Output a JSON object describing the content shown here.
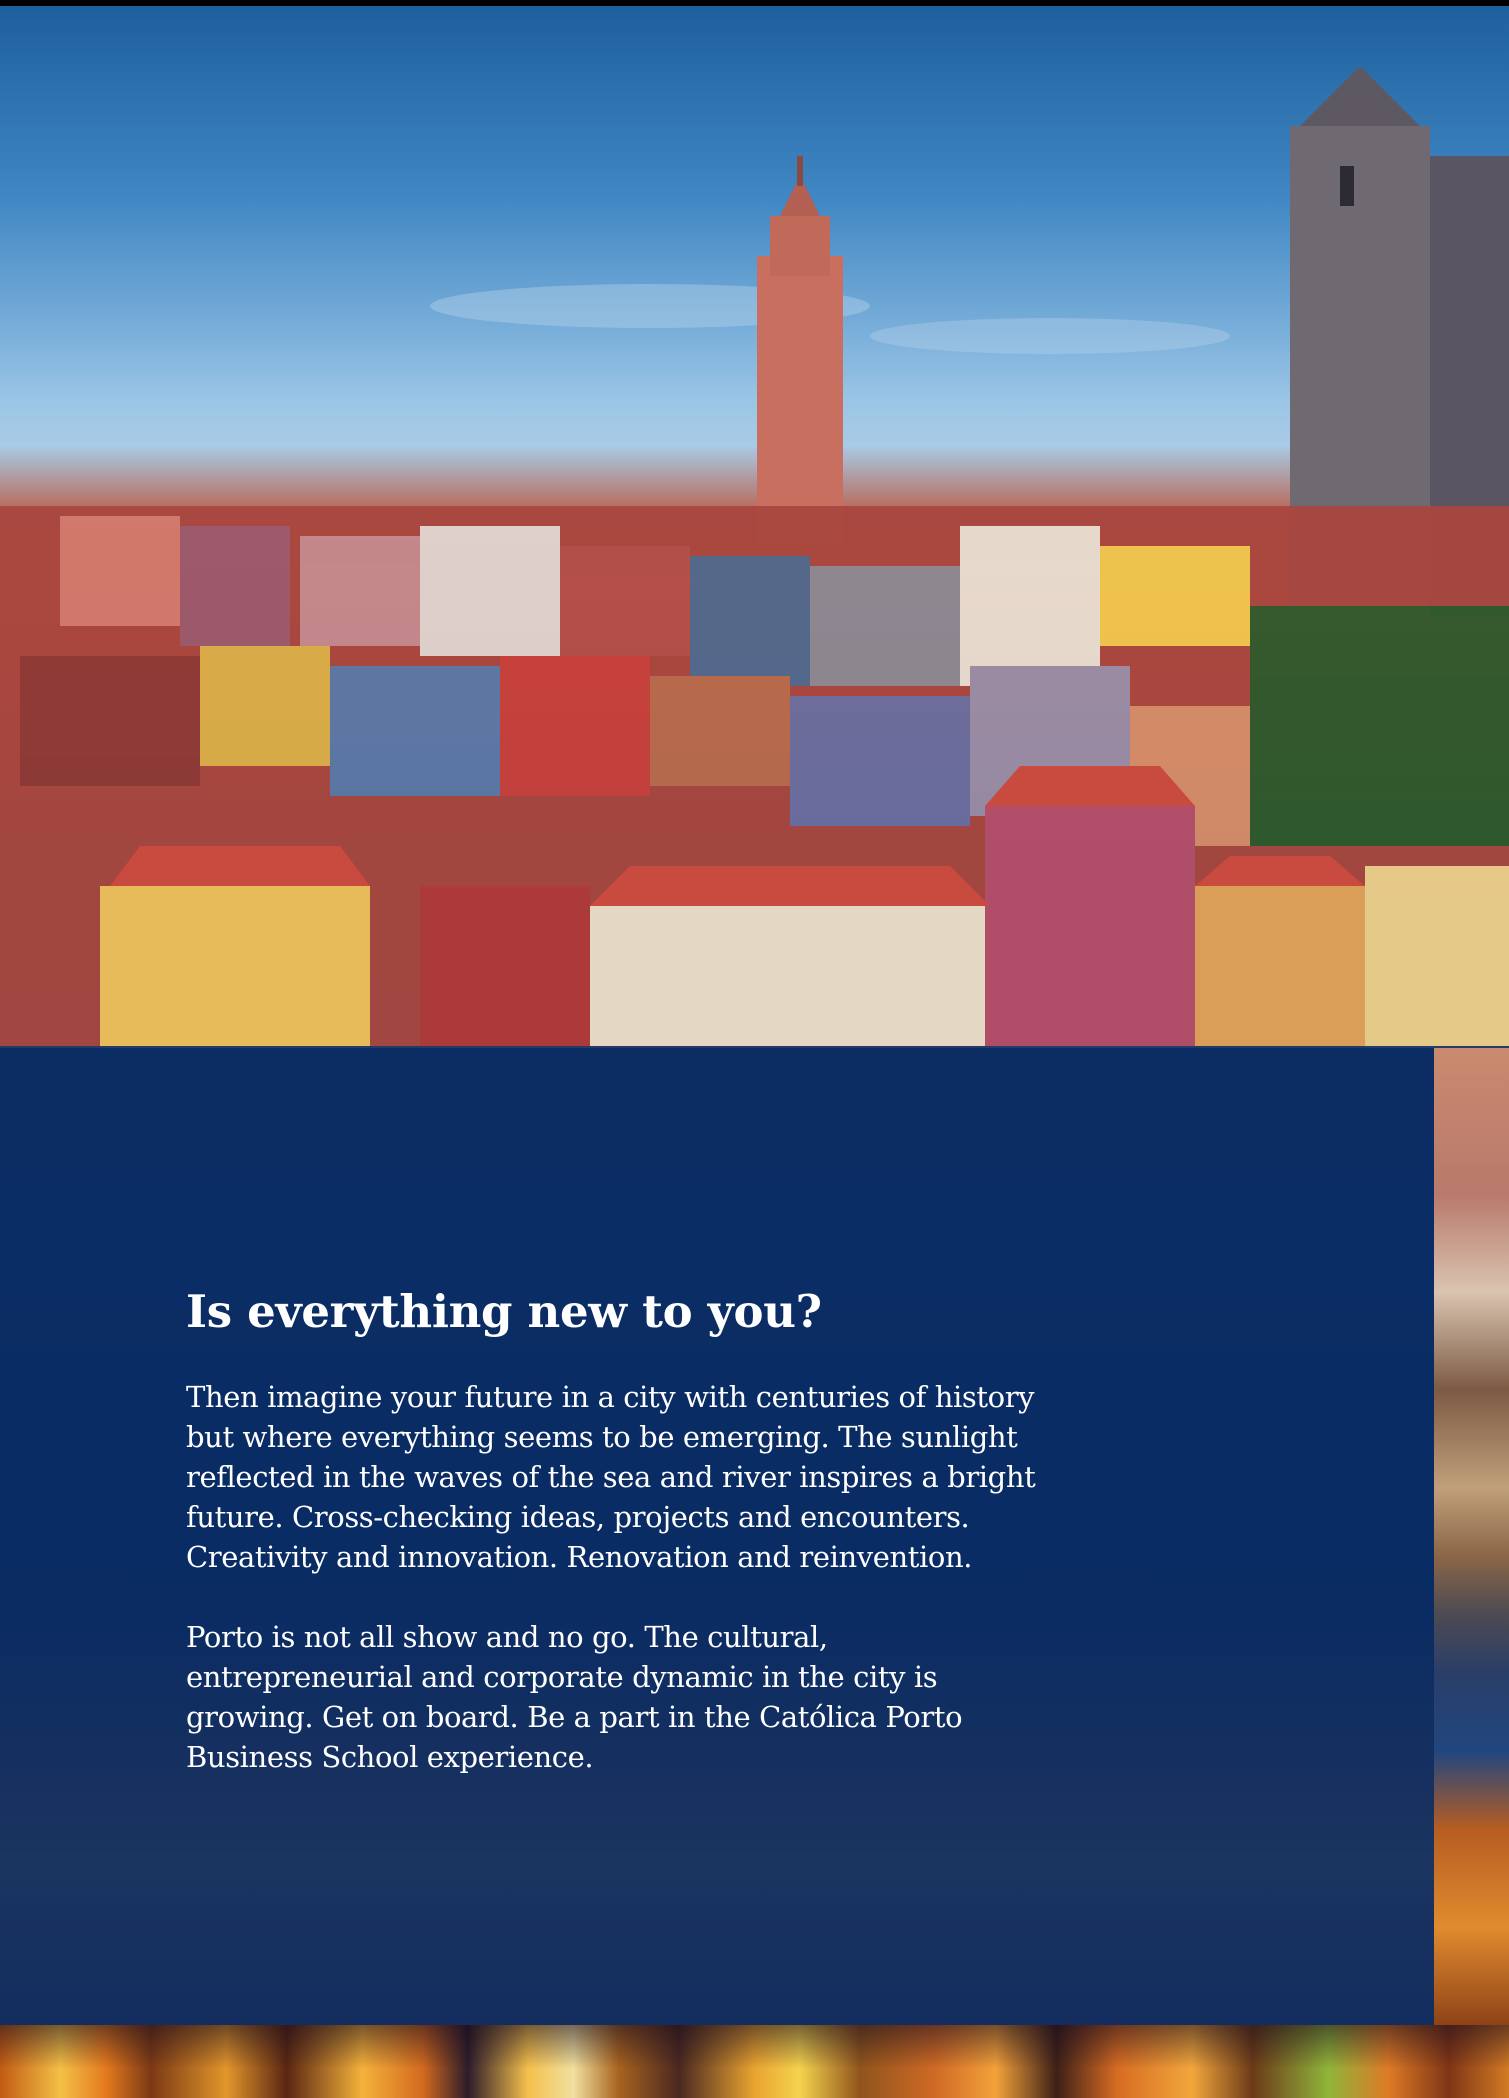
{
  "page": {
    "colors": {
      "panel": "#0a2c64",
      "text": "#ffffff",
      "sky": "#3f86c3",
      "roof": "#c9534a"
    }
  },
  "content": {
    "headline": "Is everything new to you?",
    "paragraphs": [
      "Then imagine your future in a city with centuries of history but where everything seems to be emerging. The sunlight reflected in the waves of the sea and river inspires a bright future. Cross-checking ideas, projects and encounters. Creativity and innovation. Renovation and reinvention.",
      "Porto is not all show and no go. The cultural, entrepreneurial and corporate dynamic in the city is growing. Get on board. Be a part in the Católica Porto Business School experience."
    ]
  }
}
